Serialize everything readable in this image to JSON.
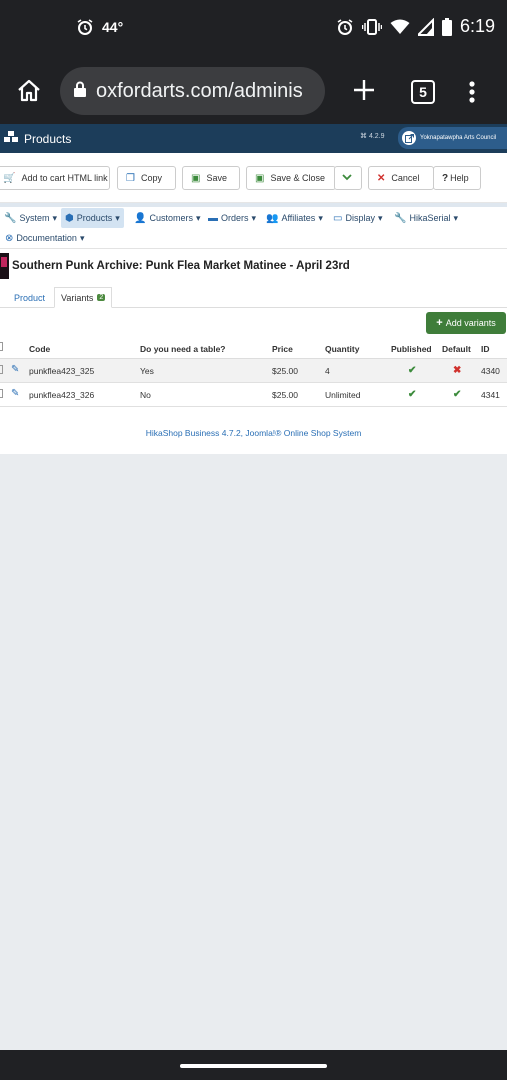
{
  "status_bar": {
    "temperature": "44°",
    "time": "6:19"
  },
  "browser": {
    "url": "oxfordarts.com/adminis",
    "tab_count": "5"
  },
  "admin_header": {
    "title": "Products",
    "version": "⌘ 4.2.9",
    "site_name": "Yoknapatawpha Arts Council"
  },
  "toolbar": {
    "add_to_cart": "Add to cart HTML link",
    "copy": "Copy",
    "save": "Save",
    "save_close": "Save & Close",
    "cancel": "Cancel",
    "help": "Help"
  },
  "menu": {
    "system": "System",
    "products": "Products",
    "customers": "Customers",
    "orders": "Orders",
    "affiliates": "Affiliates",
    "display": "Display",
    "hikaserial": "HikaSerial",
    "documentation": "Documentation"
  },
  "product": {
    "title": "Southern Punk Archive: Punk Flea Market Matinee - April 23rd"
  },
  "tabs": {
    "product": "Product",
    "variants": "Variants",
    "variants_count": "2"
  },
  "add_variants": "Add variants",
  "table": {
    "headers": {
      "code": "Code",
      "question": "Do you need a table?",
      "price": "Price",
      "quantity": "Quantity",
      "published": "Published",
      "default": "Default",
      "id": "ID"
    },
    "rows": [
      {
        "code": "punkflea423_325",
        "answer": "Yes",
        "price": "$25.00",
        "quantity": "4",
        "published": "✔",
        "default": "✖",
        "id": "4340"
      },
      {
        "code": "punkflea423_326",
        "answer": "No",
        "price": "$25.00",
        "quantity": "Unlimited",
        "published": "✔",
        "default": "✔",
        "id": "4341"
      }
    ]
  },
  "footer": "HikaShop Business 4.7.2, Joomla!® Online Shop System",
  "colors": {
    "admin_header": "#1c3d5a",
    "add_variants": "#3f7d3a",
    "link": "#2a6fb5",
    "chrome": "#202124"
  }
}
